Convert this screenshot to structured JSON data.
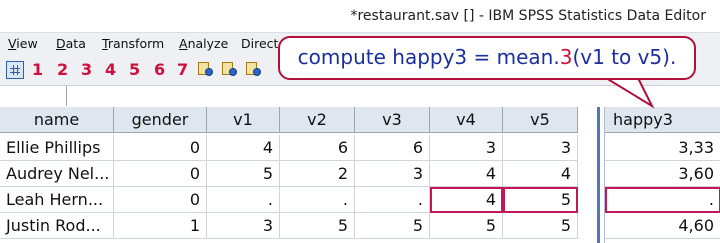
{
  "window": {
    "title": "*restaurant.sav [] - IBM SPSS Statistics Data Editor"
  },
  "menu": [
    {
      "label": "View",
      "underline": "V",
      "rest": "iew"
    },
    {
      "label": "Data",
      "underline": "D",
      "rest": "ata"
    },
    {
      "label": "Transform",
      "underline": "T",
      "rest": "ransform"
    },
    {
      "label": "Analyze",
      "underline": "A",
      "rest": "nalyze"
    },
    {
      "label": "Direct",
      "underline": "",
      "rest": "Direct"
    }
  ],
  "toolbar": {
    "numbers": [
      "1",
      "2",
      "3",
      "4",
      "5",
      "6",
      "7"
    ]
  },
  "callout": {
    "before": "compute happy3 = mean.",
    "highlight": "3",
    "after": "(v1 to v5)."
  },
  "grid": {
    "headers": [
      "name",
      "gender",
      "v1",
      "v2",
      "v3",
      "v4",
      "v5"
    ],
    "rows": [
      [
        "Ellie Phillips",
        "0",
        "4",
        "6",
        "6",
        "3",
        "3"
      ],
      [
        "Audrey Nel...",
        "0",
        "5",
        "2",
        "3",
        "4",
        "4"
      ],
      [
        "Leah Hern...",
        "0",
        ".",
        ".",
        ".",
        "4",
        "5"
      ],
      [
        "Justin Rod...",
        "1",
        "3",
        "5",
        "5",
        "5",
        "5"
      ]
    ],
    "right_header": "happy3",
    "right_values": [
      "3,33",
      "3,60",
      ".",
      "4,60"
    ]
  },
  "colors": {
    "accent_red": "#d0103a",
    "callout_text": "#1b2f9e",
    "highlight_border": "#c2185b",
    "split_blue": "#4f78b9"
  }
}
